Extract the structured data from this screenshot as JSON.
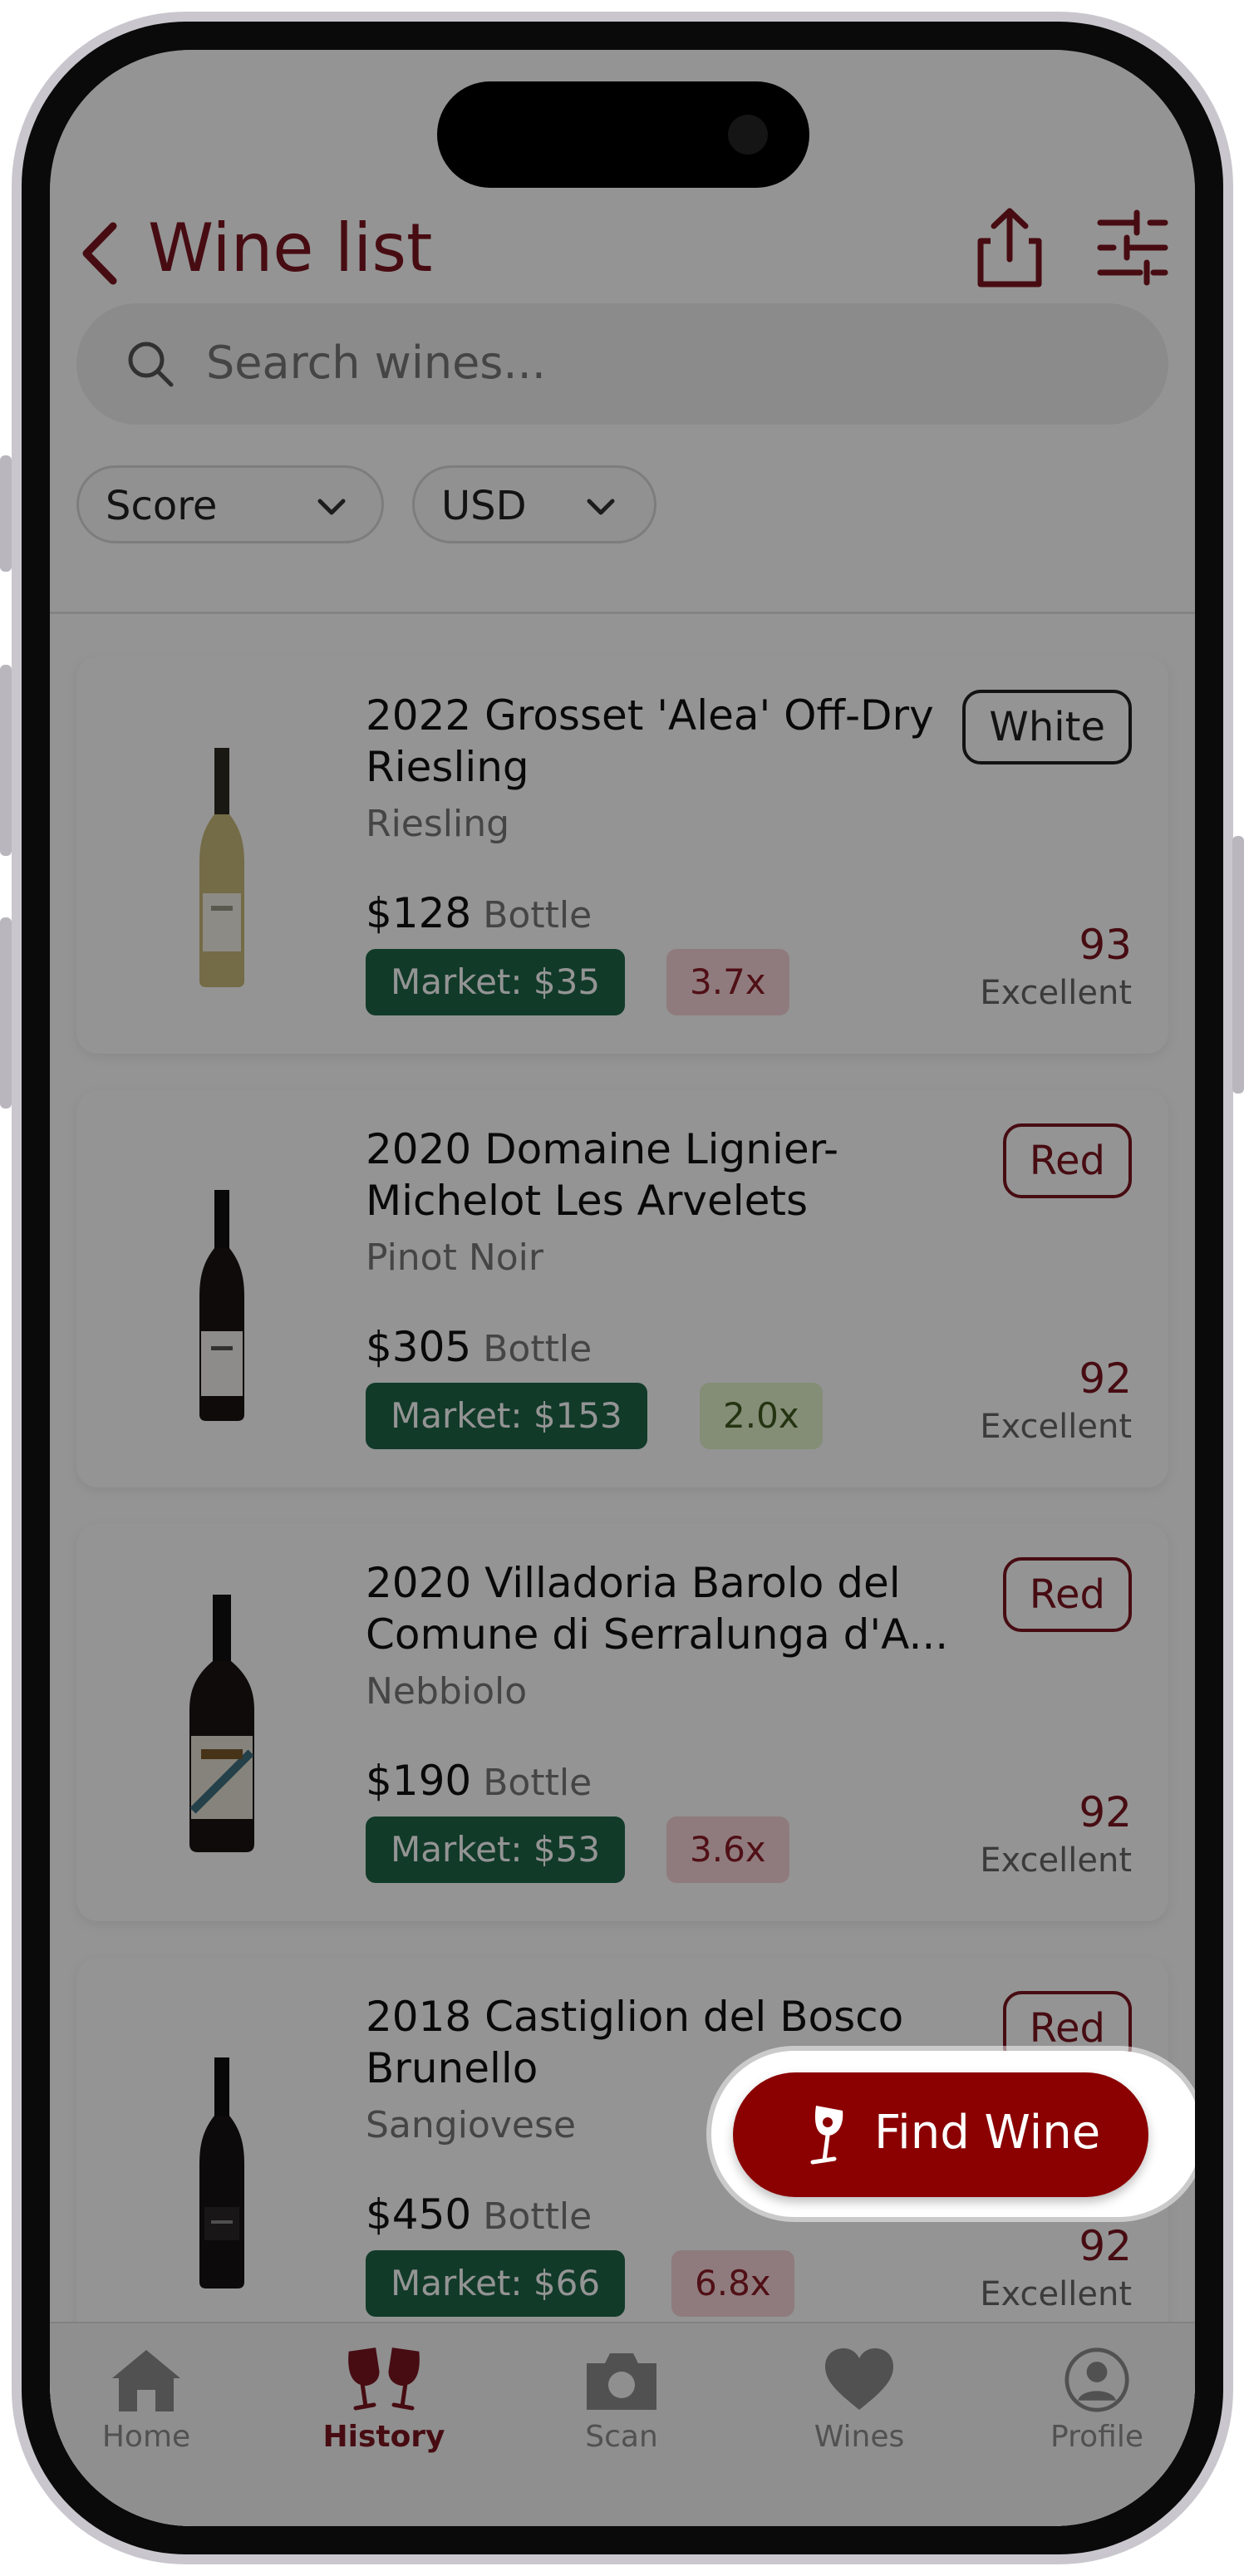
{
  "header": {
    "title": "Wine list"
  },
  "search": {
    "placeholder": "Search wines..."
  },
  "filters": {
    "sort_label": "Score",
    "currency_label": "USD"
  },
  "wines": [
    {
      "name_line1": "2022 Grosset 'Alea' Off-Dry",
      "name_line2": "Riesling",
      "grape": "Riesling",
      "price": "$128",
      "unit": "Bottle",
      "market": "Market: $35",
      "ratio": "3.7x",
      "type": "White",
      "score": "93",
      "score_label": "Excellent"
    },
    {
      "name_line1": "2020 Domaine Lignier-",
      "name_line2": "Michelot Les Arvelets",
      "grape": "Pinot Noir",
      "price": "$305",
      "unit": "Bottle",
      "market": "Market: $153",
      "ratio": "2.0x",
      "type": "Red",
      "score": "92",
      "score_label": "Excellent"
    },
    {
      "name_line1": "2020 Villadoria Barolo del",
      "name_line2": "Comune di Serralunga d'A...",
      "grape": "Nebbiolo",
      "price": "$190",
      "unit": "Bottle",
      "market": "Market: $53",
      "ratio": "3.6x",
      "type": "Red",
      "score": "92",
      "score_label": "Excellent"
    },
    {
      "name_line1": "2018 Castiglion del Bosco",
      "name_line2": "Brunello",
      "grape": "Sangiovese",
      "price": "$450",
      "unit": "Bottle",
      "market": "Market: $66",
      "ratio": "6.8x",
      "type": "Red",
      "score": "92",
      "score_label": "Excellent"
    }
  ],
  "fab": {
    "label": "Find Wine"
  },
  "tabs": [
    {
      "label": "Home"
    },
    {
      "label": "History"
    },
    {
      "label": "Scan"
    },
    {
      "label": "Wines"
    },
    {
      "label": "Profile"
    }
  ],
  "colors": {
    "brand": "#7a1520",
    "fab": "#8b0000",
    "market_badge": "#1e6448"
  }
}
